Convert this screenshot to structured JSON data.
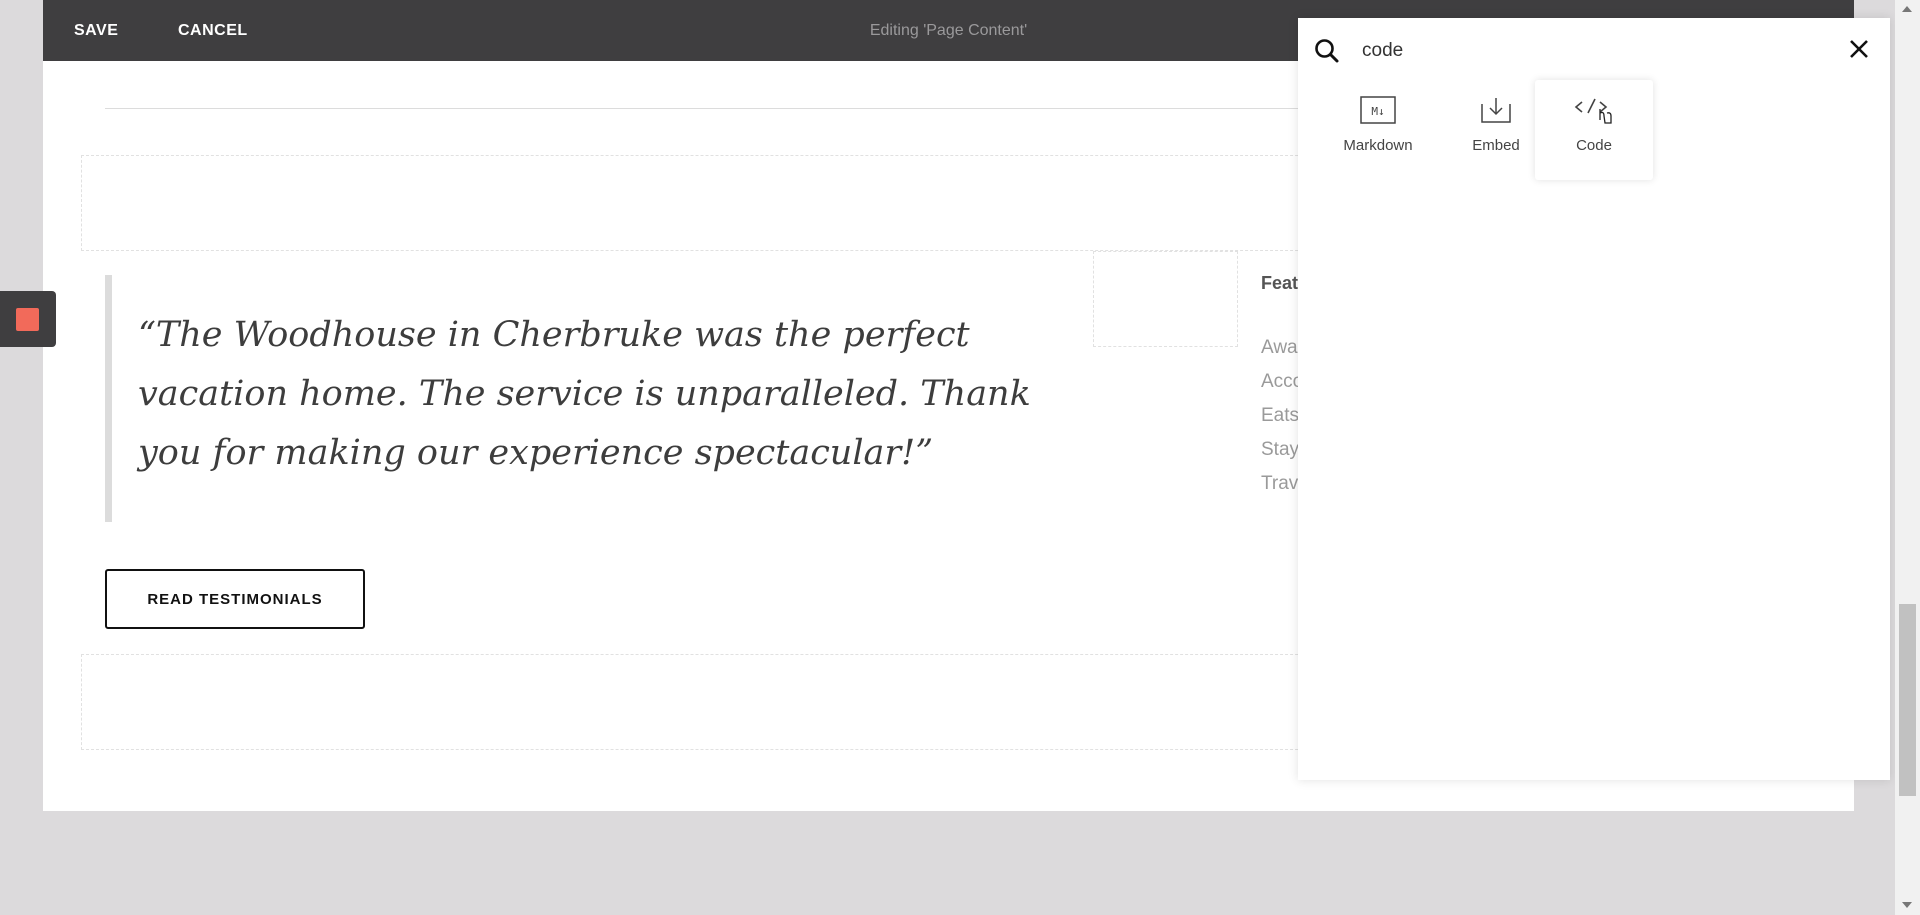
{
  "toolbar": {
    "save_label": "SAVE",
    "cancel_label": "CANCEL",
    "title": "Editing 'Page Content'"
  },
  "content": {
    "quote": "“The Woodhouse in Cherbruke was the perfect vacation home. The service is unparalleled. Thank you for making our experience spectacular!”",
    "read_button_label": "READ TESTIMONIALS",
    "featured_heading": "Feat",
    "featured_items": [
      "Awa",
      "Acco",
      "Eats",
      "Stay",
      "Trav"
    ]
  },
  "block_picker": {
    "search_value": "code",
    "results": [
      {
        "label": "Markdown",
        "icon": "markdown-icon"
      },
      {
        "label": "Embed",
        "icon": "embed-icon"
      },
      {
        "label": "Code",
        "icon": "code-icon"
      }
    ]
  },
  "colors": {
    "toolbar_bg": "#3f3e40",
    "accent_tab": "#f26a5a"
  }
}
